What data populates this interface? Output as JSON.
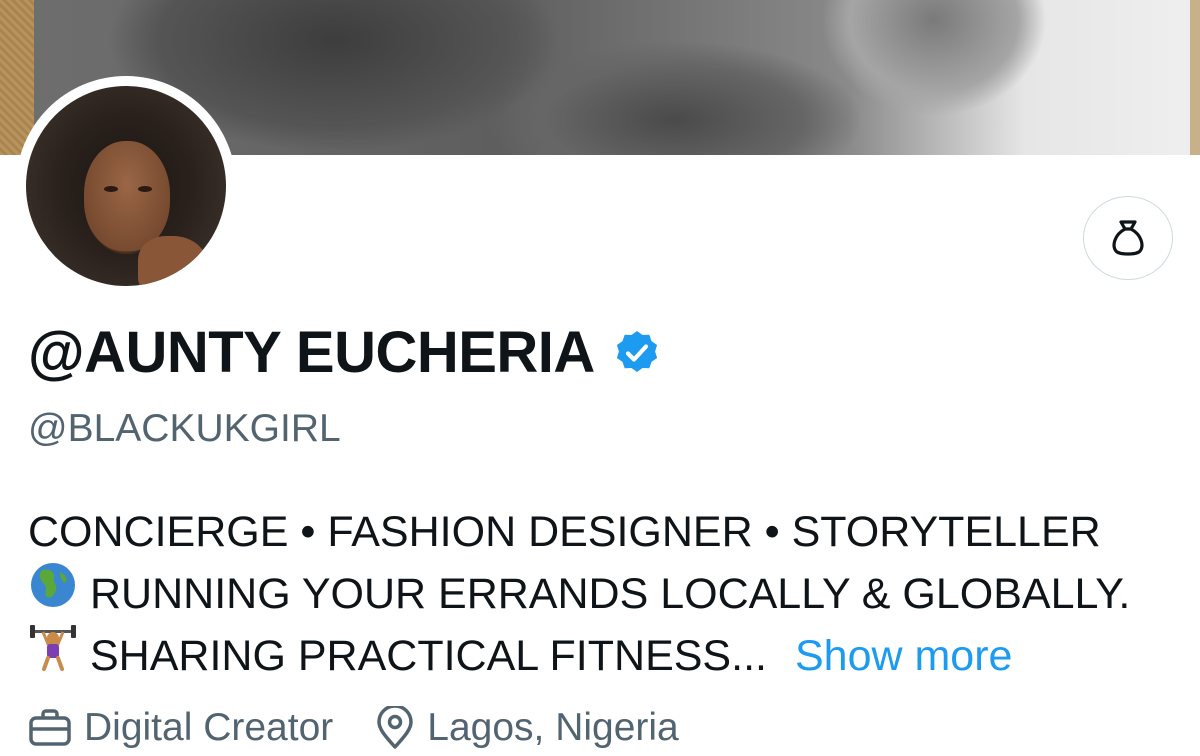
{
  "profile": {
    "display_name": "@AUNTY EUCHERIA",
    "handle": "@BLACKUKGIRL",
    "verified": true,
    "verified_color": "#1d9bf0"
  },
  "bio": {
    "line1": "CONCIERGE • FASHION DESIGNER • STORYTELLER",
    "line2_icon": "globe-emoji",
    "line2": "RUNNING YOUR ERRANDS LOCALLY & GLOBALLY.",
    "line3_icon": "weightlifter-emoji",
    "line3": "SHARING PRACTICAL FITNESS...",
    "show_more_label": "Show more"
  },
  "meta": {
    "category_icon": "briefcase-icon",
    "category": "Digital Creator",
    "location_icon": "location-pin-icon",
    "location": "Lagos, Nigeria"
  },
  "actions": {
    "gift_icon": "money-bag-icon"
  },
  "colors": {
    "link": "#1d9bf0",
    "secondary_text": "#536471",
    "primary_text": "#0f1419"
  }
}
